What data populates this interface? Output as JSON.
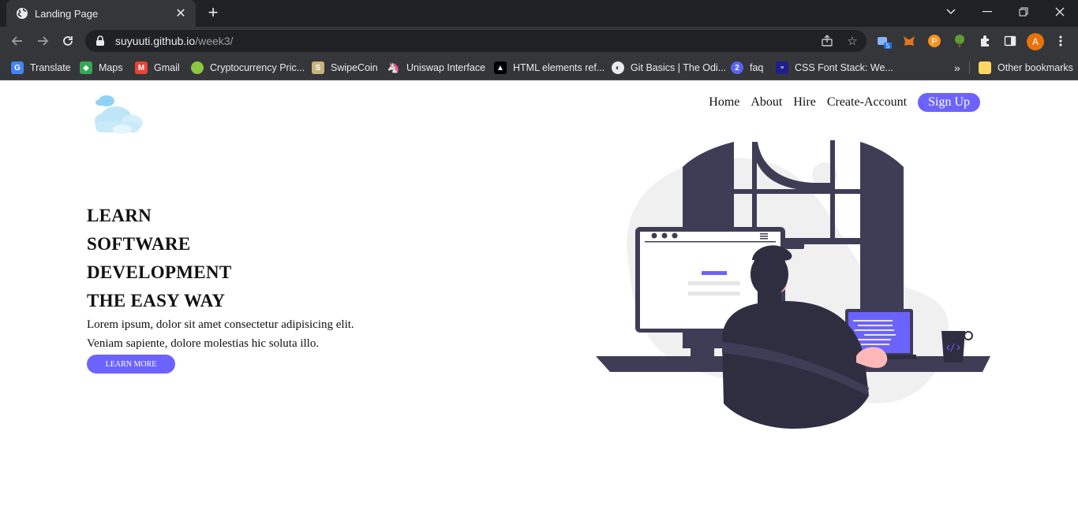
{
  "browser": {
    "tab": {
      "title": "Landing Page"
    },
    "url": {
      "host": "suyuuti.github.io",
      "path": "/week3/"
    },
    "extension_badge": "5",
    "profile_initial": "A",
    "bookmarks": [
      {
        "label": "Translate",
        "icon": "google-translate-icon",
        "color": "#4285f4"
      },
      {
        "label": "Maps",
        "icon": "google-maps-icon",
        "color": "#34a853"
      },
      {
        "label": "Gmail",
        "icon": "gmail-icon",
        "color": "#ea4335"
      },
      {
        "label": "Cryptocurrency Pric...",
        "icon": "coingecko-icon",
        "color": "#8dc63f"
      },
      {
        "label": "SwipeCoin",
        "icon": "swipecoin-icon",
        "color": "#c9b27c"
      },
      {
        "label": "Uniswap Interface",
        "icon": "uniswap-icon",
        "color": "#35363a"
      },
      {
        "label": "HTML elements ref...",
        "icon": "mdn-icon",
        "color": "#000000"
      },
      {
        "label": "Git Basics | The Odi...",
        "icon": "odin-icon",
        "color": "#35363a"
      },
      {
        "label": "faq",
        "icon": "faq-icon",
        "color": "#5865f2"
      },
      {
        "label": "CSS Font Stack: We...",
        "icon": "cssfontstack-icon",
        "color": "#1e1e8c"
      }
    ],
    "other_bookmarks": "Other bookmarks"
  },
  "site": {
    "nav": [
      "Home",
      "About",
      "Hire",
      "Create-Account"
    ],
    "signup": "Sign Up",
    "hero": {
      "line1": "LEARN",
      "line2": "SOFTWARE",
      "line3": "DEVELOPMENT",
      "line4": "THE EASY WAY",
      "para1": "Lorem ipsum, dolor sit amet consectetur adipisicing elit.",
      "para2": "Veniam sapiente, dolore molestias hic soluta illo.",
      "button": "LEARN MORE"
    },
    "accent": "#6c63ff",
    "dark": "#3f3d56"
  }
}
